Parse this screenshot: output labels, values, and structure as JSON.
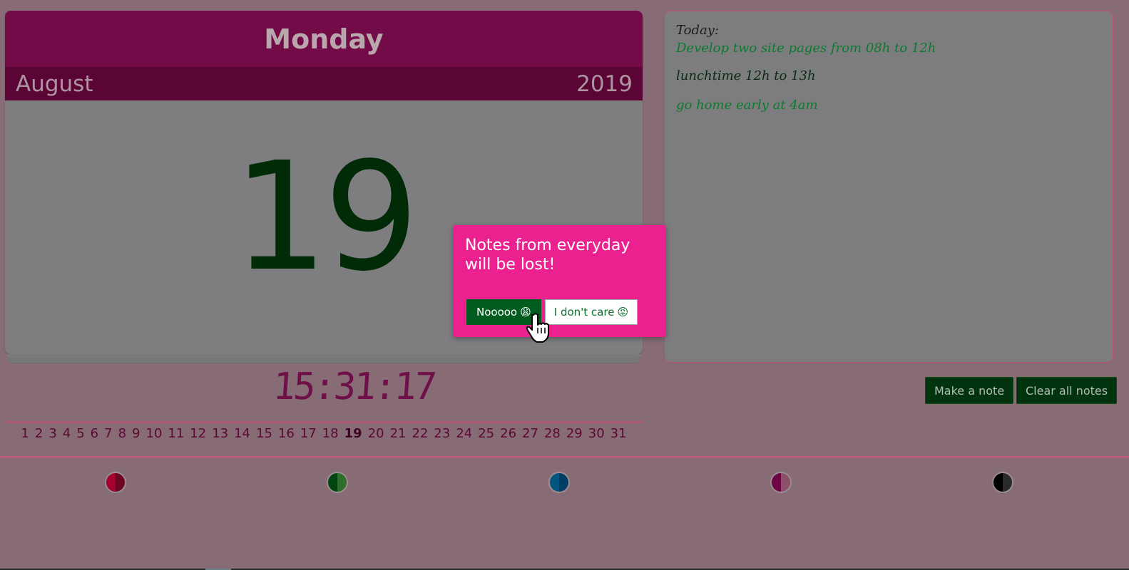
{
  "calendar": {
    "day_name": "Monday",
    "month": "August",
    "year": "2019",
    "date": "19",
    "card_colors": {
      "day_bar": "#720b48",
      "month_bar": "#5a0535",
      "date": "#012b07"
    }
  },
  "clock": {
    "time": "15:31:17"
  },
  "days": {
    "list": [
      "1",
      "2",
      "3",
      "4",
      "5",
      "6",
      "7",
      "8",
      "9",
      "10",
      "11",
      "12",
      "13",
      "14",
      "15",
      "16",
      "17",
      "18",
      "19",
      "20",
      "21",
      "22",
      "23",
      "24",
      "25",
      "26",
      "27",
      "28",
      "29",
      "30",
      "31"
    ],
    "active": "19"
  },
  "themes": [
    {
      "name": "red",
      "left": "#a5002f",
      "right": "#6e0520"
    },
    {
      "name": "green",
      "left": "#01460f",
      "right": "#2e6e2a"
    },
    {
      "name": "blue",
      "left": "#00567f",
      "right": "#003e63"
    },
    {
      "name": "purple",
      "left": "#6e0544",
      "right": "#8d5069"
    },
    {
      "name": "black",
      "left": "#000000",
      "right": "#2a2a2a"
    }
  ],
  "notes": {
    "heading": "Today:",
    "items": [
      {
        "text": "Develop two site pages from 08h to 12h",
        "color": "#0c7a2e"
      },
      {
        "text": "lunchtime 12h to 13h",
        "color": "#0a2b12"
      },
      {
        "text": "go home early at 4am",
        "color": "#0c7a2e"
      }
    ]
  },
  "actions": {
    "make_note": "Make a note",
    "clear_notes": "Clear all notes"
  },
  "modal": {
    "message": "Notes from everyday will be lost!",
    "confirm": "Nooooo",
    "confirm_emoji": "😩",
    "cancel": "I don't care",
    "cancel_emoji": "😡"
  }
}
